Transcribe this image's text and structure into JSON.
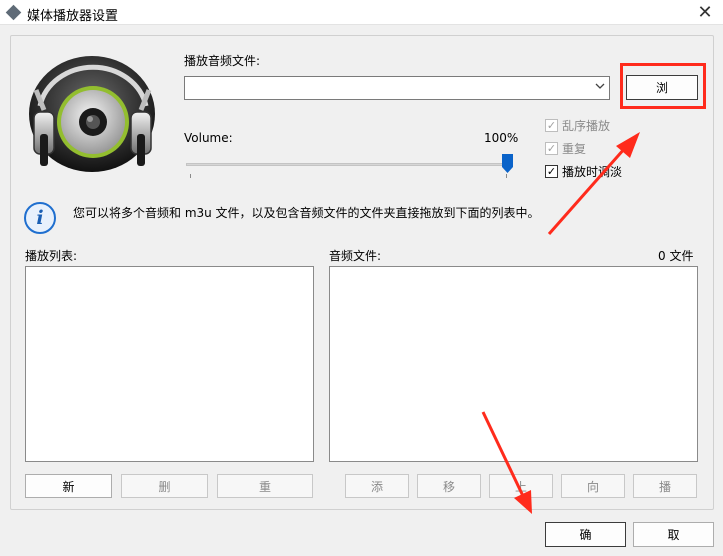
{
  "window": {
    "title": "媒体播放器设置",
    "close_glyph": "✕"
  },
  "audio_file": {
    "label": "播放音频文件:",
    "value": "",
    "browse_label": "浏"
  },
  "volume": {
    "label": "Volume:",
    "percent_text": "100%",
    "level": 1.0
  },
  "options": {
    "shuffle": {
      "label": "乱序播放",
      "checked": true,
      "enabled": false
    },
    "repeat": {
      "label": "重复",
      "checked": true,
      "enabled": false
    },
    "fade": {
      "label": "播放时调淡",
      "checked": true,
      "enabled": true
    }
  },
  "info": {
    "text": "您可以将多个音频和 m3u 文件，以及包含音频文件的文件夹直接拖放到下面的列表中。"
  },
  "playlist": {
    "label": "播放列表:",
    "items": [],
    "buttons": {
      "new": "新",
      "delete": "删",
      "rename": "重"
    }
  },
  "audio_files": {
    "label": "音频文件:",
    "count_text": "0 文件",
    "items": [],
    "buttons": {
      "add": "添",
      "remove": "移",
      "up": "上",
      "down": "向",
      "play": "播"
    }
  },
  "footer": {
    "ok_label": "确",
    "cancel_label": "取"
  },
  "colors": {
    "annotation_red": "#ff2b1c",
    "accent_blue": "#0a63c9",
    "speaker_ring": "#9bc23c"
  },
  "icons": {
    "app": "diamond-app-icon",
    "info": "info-icon",
    "speaker": "speaker-headphones-icon",
    "combo": "chevron-down-icon"
  }
}
